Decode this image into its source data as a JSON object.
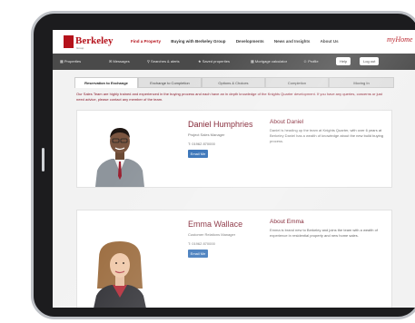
{
  "header": {
    "logo_text": "Berkeley",
    "logo_sub": "Group",
    "nav": {
      "find": "Find a Property",
      "buying": "Buying with Berkeley Group",
      "developments": "Developments",
      "news": "News and Insights",
      "about": "About Us"
    },
    "home_logo": "myHome"
  },
  "toolbar": {
    "properties": "Properties",
    "messages": "Messages",
    "search_alerts": "Searches & alerts",
    "saved": "Saved properties",
    "mortgage": "Mortgage calculator",
    "profile": "Profile",
    "help": "Help",
    "logout": "Log out"
  },
  "tabs": [
    {
      "label": "Reservation to Exchange"
    },
    {
      "label": "Exchange to Completion"
    },
    {
      "label": "Options & Choices"
    },
    {
      "label": "Completion"
    },
    {
      "label": "Moving In"
    }
  ],
  "intro": "Our Sales Team are highly trained and experienced in the buying process and each have an in depth knowledge of the Knights Quarter development. If you have any queries, concerns or just need advice, please contact any member of the team.",
  "contacts": [
    {
      "name": "Daniel Humphries",
      "role": "Project Sales Manager",
      "phone": "T: 01962 870000",
      "email_label": "Email Me",
      "about_title": "About Daniel",
      "about_text": "Daniel is heading up the team at Knights Quarter, with over 6 years at Berkeley Daniel has a wealth of knowledge about the new build buying process."
    },
    {
      "name": "Emma Wallace",
      "role": "Customer Relations Manager",
      "phone": "T: 01962 870000",
      "email_label": "Email Me",
      "about_title": "About Emma",
      "about_text": "Emma is brand new to Berkeley and joins the team with a wealth of experience in residential property and new home sales."
    }
  ],
  "colors": {
    "brand": "#b5121b",
    "toolbar": "#4a4a4a",
    "button": "#2f6db5",
    "heading": "#7a1526"
  }
}
